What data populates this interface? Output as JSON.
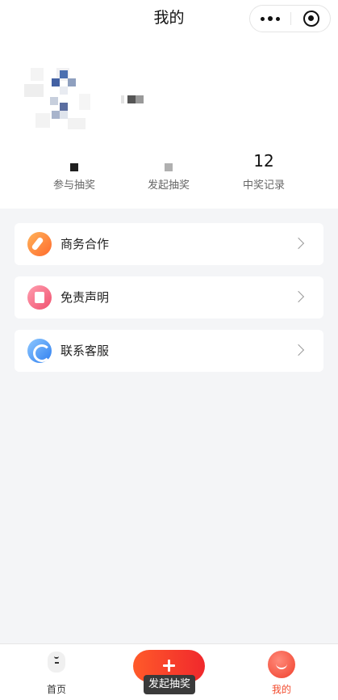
{
  "navbar": {
    "title": "我的"
  },
  "capsule": {
    "more_icon": "more-dots-icon",
    "close_icon": "target-icon"
  },
  "profile": {
    "stats": [
      {
        "value": "",
        "label": "参与抽奖"
      },
      {
        "value": "",
        "label": "发起抽奖"
      },
      {
        "value": "12",
        "label": "中奖记录"
      }
    ]
  },
  "menu": [
    {
      "label": "商务合作",
      "icon": "business-pen-icon"
    },
    {
      "label": "免责声明",
      "icon": "disclaimer-doc-icon"
    },
    {
      "label": "联系客服",
      "icon": "customer-service-icon"
    }
  ],
  "tabbar": {
    "home_label": "首页",
    "create_label": "发起抽奖",
    "mine_label": "我的"
  },
  "colors": {
    "accent": "#f24a2c",
    "background": "#f4f5f7"
  }
}
